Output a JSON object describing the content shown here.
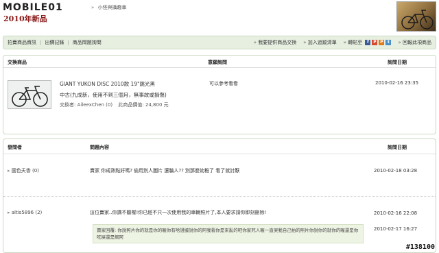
{
  "header": {
    "logo_text": "MOBILE01",
    "logo_sub": "2010年新品",
    "breadcrumb": [
      "»",
      "小怪與攝趣車"
    ]
  },
  "toolbar": {
    "tabs": [
      "拍賣商品資訊",
      "出價記錄",
      "商品問題詢問"
    ],
    "actions": [
      "我要提供商品交換",
      "加入追蹤清單",
      "轉貼至",
      "回報此項商品"
    ],
    "share_colors": [
      "#3b5998",
      "#d44a2e",
      "#e07b1a",
      "#4a90c8"
    ],
    "share_letters": [
      "f",
      "P",
      "P",
      "t"
    ]
  },
  "item": {
    "headers": {
      "product": "交換商品",
      "question": "意願詢問",
      "date": "詢問日期"
    },
    "title": "GIANT YUKON DISC 2010款 19\"跳光黑",
    "condition": "中古(九成新，使用不到三個月，無事故或損傷)",
    "seller_label": "交換者: AileexChen (0)",
    "price_label": "此商品價值: 24,800 元",
    "question": "可以參考看看",
    "date": "2010-02-16 23:35"
  },
  "qa": {
    "headers": {
      "asker": "發問者",
      "content": "問題內容",
      "date": "詢問日期"
    },
    "rows": [
      {
        "asker": "園色夭香 (0)",
        "question": "賣家 你成熟點好嗎? 偷用別人圖片 還騙人?? 別那麼幼稚了 看了就討厭",
        "date": "2010-02-18 03:28"
      },
      {
        "asker": "altis5896 (2)",
        "question": "這位賣家..你講不聽喔!你已經不只一次使用我的車輛照片了,本人要求請你即刻刪除!",
        "date": "2010-02-16 22:08",
        "reply": "賣家回覆: 你說照片你的就是你的喔你有啥證據說你的阿我看你是來亂的吧你家死人喔一直哭我自己拍的照片你說你的就你的喔還是你吃屎還是飼阿",
        "reply_date": "2010-02-17 16:27"
      }
    ]
  },
  "watermark": "#138100"
}
